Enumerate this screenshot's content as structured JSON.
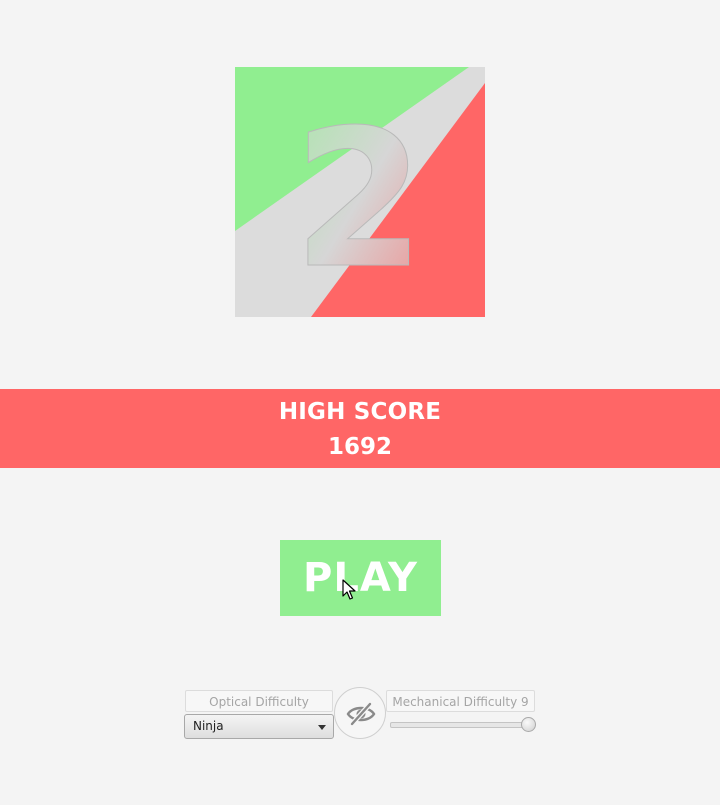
{
  "logo": {
    "digit": "2",
    "colors": {
      "green": "#90ee90",
      "grey": "#dcdcdc",
      "red": "#ff6666"
    }
  },
  "high_score": {
    "title": "HIGH SCORE",
    "value": "1692",
    "color": "#ff6666"
  },
  "play": {
    "label": "PLAY",
    "color": "#90ee90"
  },
  "controls": {
    "optical_label": "Optical Difficulty",
    "optical_selected": "Ninja",
    "visibility_toggle_icon": "eye-slash-icon",
    "mechanical_label": "Mechanical Difficulty 9",
    "mechanical_level": 9,
    "mechanical_slider_fraction": 1.0
  }
}
